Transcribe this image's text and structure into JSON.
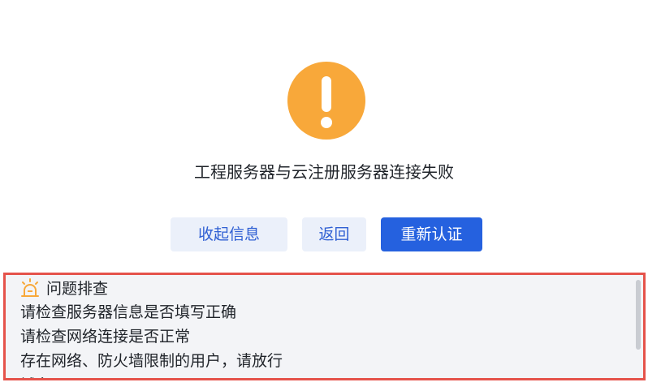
{
  "colors": {
    "warning": "#f8a83a",
    "primary": "#2561df",
    "secondary_bg": "#ebf0fa",
    "panel_border": "#e5534b"
  },
  "status": {
    "icon": "exclamation-circle-icon",
    "message": "工程服务器与云注册服务器连接失败"
  },
  "actions": {
    "collapse_label": "收起信息",
    "back_label": "返回",
    "reauth_label": "重新认证"
  },
  "troubleshoot": {
    "icon": "alarm-light-icon",
    "title": "问题排查",
    "items": [
      "请检查服务器信息是否填写正确",
      "请检查网络连接是否正常",
      "存在网络、防火墙限制的用户，请放行",
      "域名：https://registry.f..."
    ]
  }
}
